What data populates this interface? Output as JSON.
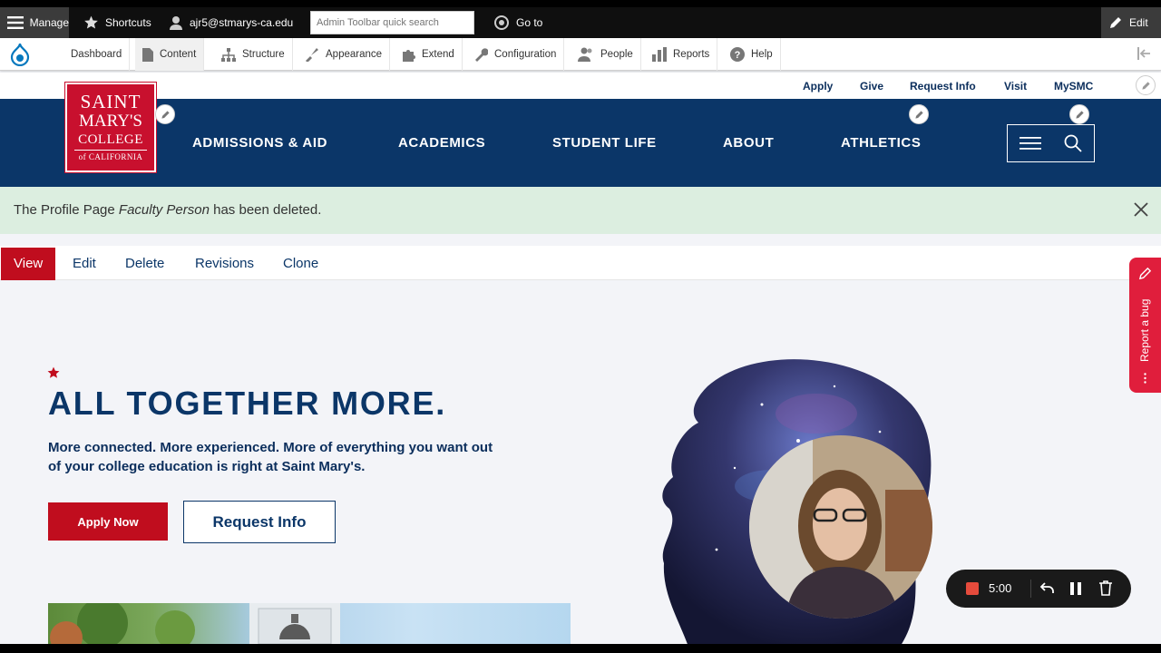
{
  "admin_toolbar": {
    "manage": "Manage",
    "shortcuts": "Shortcuts",
    "user": "ajr5@stmarys-ca.edu",
    "search_placeholder": "Admin Toolbar quick search",
    "goto": "Go to",
    "edit": "Edit"
  },
  "admin_menu": [
    {
      "label": "Dashboard"
    },
    {
      "label": "Content"
    },
    {
      "label": "Structure"
    },
    {
      "label": "Appearance"
    },
    {
      "label": "Extend"
    },
    {
      "label": "Configuration"
    },
    {
      "label": "People"
    },
    {
      "label": "Reports"
    },
    {
      "label": "Help"
    }
  ],
  "utility_nav": [
    "Apply",
    "Give",
    "Request Info",
    "Visit",
    "MySMC"
  ],
  "logo": {
    "line1": "SAINT",
    "line2": "MARY'S",
    "line3": "COLLEGE",
    "line4": "of CALIFORNIA"
  },
  "main_nav": [
    "ADMISSIONS & AID",
    "ACADEMICS",
    "STUDENT LIFE",
    "ABOUT",
    "ATHLETICS"
  ],
  "status": {
    "prefix": "The Profile Page ",
    "name": "Faculty Person",
    "suffix": " has been deleted."
  },
  "tabs": [
    "View",
    "Edit",
    "Delete",
    "Revisions",
    "Clone"
  ],
  "hero": {
    "headline": "ALL TOGETHER MORE.",
    "subtext": "More connected. More experienced. More of everything you want out of your college education is right at Saint Mary's.",
    "apply_button": "Apply Now",
    "request_button": "Request Info"
  },
  "report_bug": "Report a bug",
  "recorder": {
    "time": "5:00"
  },
  "colors": {
    "navy": "#0b3668",
    "red": "#c00d1e",
    "status_bg": "#dceee0"
  }
}
